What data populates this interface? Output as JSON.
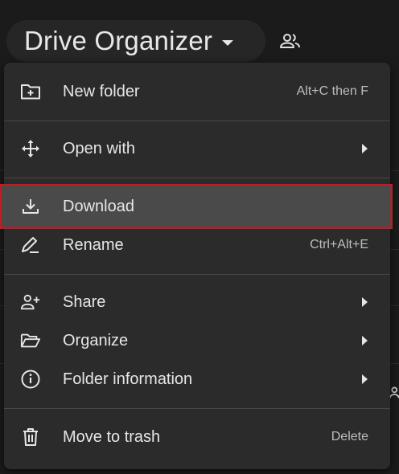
{
  "header": {
    "title": "Drive Organizer"
  },
  "menu": {
    "items": [
      {
        "label": "New folder",
        "shortcut": "Alt+C then F",
        "icon": "new-folder-icon"
      },
      {
        "label": "Open with",
        "icon": "open-with-icon",
        "submenu": true
      },
      {
        "label": "Download",
        "icon": "download-icon",
        "highlighted": true
      },
      {
        "label": "Rename",
        "shortcut": "Ctrl+Alt+E",
        "icon": "rename-icon"
      },
      {
        "label": "Share",
        "icon": "share-icon",
        "submenu": true
      },
      {
        "label": "Organize",
        "icon": "organize-icon",
        "submenu": true
      },
      {
        "label": "Folder information",
        "icon": "info-icon",
        "submenu": true
      },
      {
        "label": "Move to trash",
        "shortcut": "Delete",
        "icon": "trash-icon"
      }
    ]
  },
  "colors": {
    "background": "#1b1b1b",
    "menu": "#2b2b2b",
    "highlight": "#4a4a4a",
    "highlight_border": "#d4141c",
    "text": "#e6e6e6"
  }
}
